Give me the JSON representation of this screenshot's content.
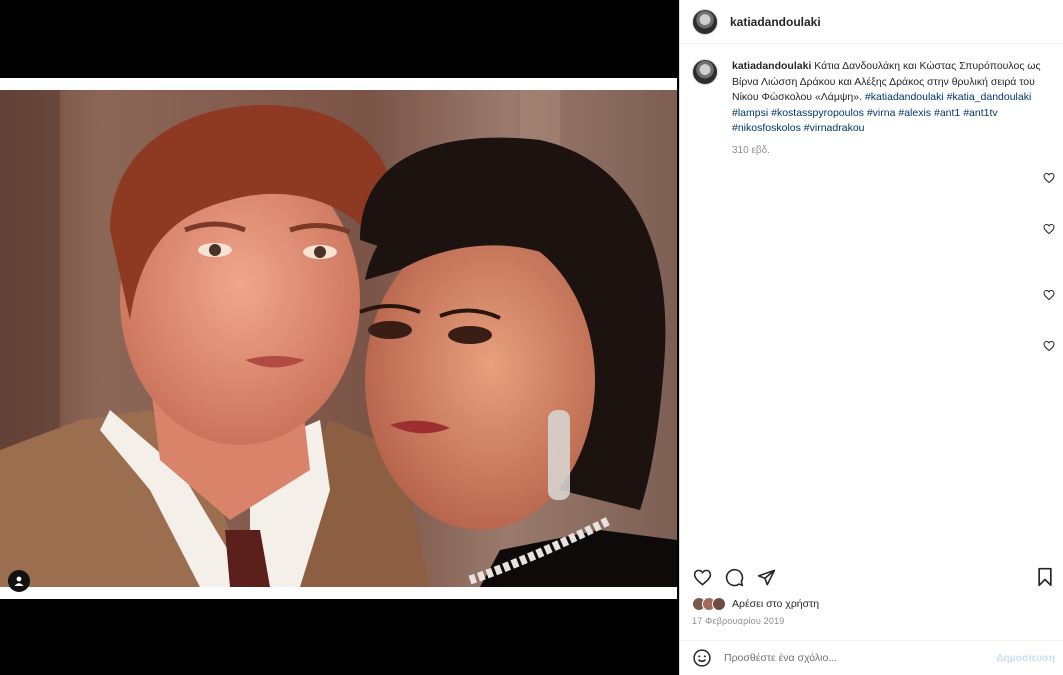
{
  "header": {
    "username": "katiadandoulaki"
  },
  "caption": {
    "username": "katiadandoulaki",
    "text": "Κάτια Δανδουλάκη και Κώστας Σπυρόπουλος ως Βίρνα Λιώσση Δράκου και Αλέξης Δράκος στην θρυλική σειρά του Νίκου Φώσκολου «Λάμψη».",
    "hashtags": [
      "#katiadandoulaki",
      "#katia_dandoulaki",
      "#lampsi",
      "#kostasspyropoulos",
      "#virna",
      "#alexis",
      "#ant1",
      "#ant1tv",
      "#nikosfoskolos",
      "#virnadrakou"
    ],
    "time": "310 εβδ."
  },
  "icons": {
    "heart": "heart-outline-icon",
    "comment": "comment-bubble-icon",
    "share": "paper-plane-icon",
    "save": "bookmark-icon",
    "emoji": "smiley-face-icon",
    "tag": "user-tag-icon"
  },
  "likes": {
    "text": "Αρέσει στο χρήστη"
  },
  "date": "17 Φεβρουαρίου 2019",
  "comment_box": {
    "placeholder": "Προσθέστε ένα σχόλιο...",
    "post_label": "Δημοσίευση"
  },
  "colors": {
    "link": "#00376b",
    "muted": "#8e8e8e",
    "post_disabled": "#c7e0f4"
  }
}
